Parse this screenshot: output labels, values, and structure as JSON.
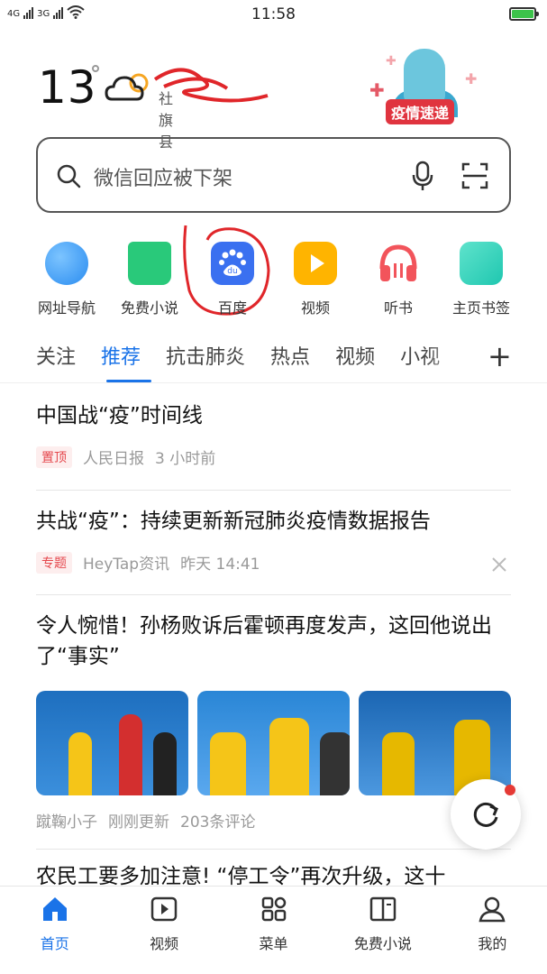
{
  "status": {
    "signal_left": "4G",
    "signal_right": "3G",
    "time": "11:58"
  },
  "weather": {
    "temp": "13",
    "location": "社旗县"
  },
  "banner": {
    "label": "疫情速递"
  },
  "search": {
    "placeholder": "微信回应被下架"
  },
  "quick_links": [
    {
      "label": "网址导航",
      "icon": "globe-icon",
      "color": "#2a8cf0"
    },
    {
      "label": "免费小说",
      "icon": "book-icon",
      "color": "#29c97a"
    },
    {
      "label": "百度",
      "icon": "baidu-paw-icon",
      "color": "#3a70f0"
    },
    {
      "label": "视频",
      "icon": "play-icon",
      "color": "#ffb400"
    },
    {
      "label": "听书",
      "icon": "headphones-icon",
      "color": "#f2545b"
    },
    {
      "label": "主页书签",
      "icon": "bookmark-icon",
      "color": "#1fc7b0"
    }
  ],
  "tabs": [
    "关注",
    "推荐",
    "抗击肺炎",
    "热点",
    "视频",
    "小视"
  ],
  "active_tab": "推荐",
  "news": [
    {
      "title": "中国战“疫”时间线",
      "badge": "置顶",
      "source": "人民日报",
      "time": "3 小时前"
    },
    {
      "title": "共战“疫”：持续更新新冠肺炎疫情数据报告",
      "badge": "专题",
      "source": "HeyTap资讯",
      "time": "昨天 14:41"
    },
    {
      "title": "令人惋惜！孙杨败诉后霍顿再度发声，这回他说出了“事实”",
      "source": "蹴鞠小子",
      "time": "刚刚更新",
      "comments": "203条评论"
    },
    {
      "title": "农民工要多加注意! “停工令”再次升级，这十"
    }
  ],
  "bottom_nav": [
    {
      "label": "首页",
      "icon": "home-icon"
    },
    {
      "label": "视频",
      "icon": "video-icon"
    },
    {
      "label": "菜单",
      "icon": "menu-grid-icon"
    },
    {
      "label": "免费小说",
      "icon": "book-icon"
    },
    {
      "label": "我的",
      "icon": "user-icon"
    }
  ],
  "colors": {
    "accent": "#1a73e8",
    "badge_red": "#e5484d",
    "annotation_red": "#e0262a"
  }
}
